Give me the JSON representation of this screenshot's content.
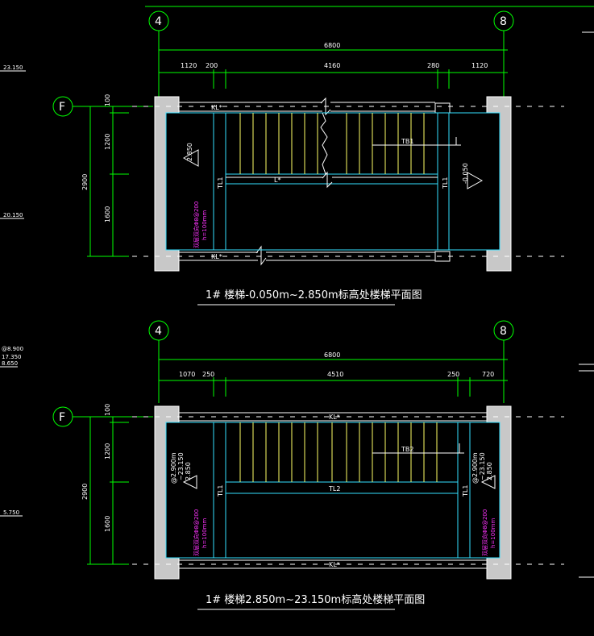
{
  "axes": {
    "left": "4",
    "right": "8",
    "row": "F"
  },
  "plan1": {
    "title": "1# 楼梯-0.050m~2.850m标高处楼梯平面图",
    "overall": "6800",
    "segments": [
      "1120",
      "200",
      "4160",
      "280",
      "1120"
    ],
    "vertical": {
      "total": "2900",
      "segments": [
        "100",
        "1200",
        "1600"
      ]
    },
    "beam_top": "KL*",
    "beam_bottom": "KL*",
    "beam_mid": "L*",
    "tb": "TB1",
    "tz_left": "TL1",
    "tz_right": "TL1",
    "level_left": "2.850",
    "level_right": "-0.050",
    "note_lines": [
      "双层双向Φ8@200",
      "h=100mm"
    ]
  },
  "plan2": {
    "title": "1# 楼梯2.850m~23.150m标高处楼梯平面图",
    "overall": "6800",
    "segments": [
      "1070",
      "250",
      "4510",
      "250",
      "720"
    ],
    "vertical": {
      "total": "2900",
      "segments": [
        "100",
        "1200",
        "1600"
      ]
    },
    "beam_top": "KL*",
    "beam_bottom": "KL*",
    "beam_mid": "TL2",
    "tb": "TB2",
    "tz_left": "TL1",
    "tz_right": "TL1",
    "level_left": [
      "@2.900m",
      "~23.150",
      "2.850"
    ],
    "level_right": [
      "@2.900m",
      "~23.150",
      "2.850"
    ],
    "note_lines": [
      "双层双向Φ8@200",
      "h=100mm"
    ]
  },
  "left_edge_levels": [
    "23.150",
    "20.150",
    "@8.900",
    "17.350",
    "8.650",
    "5.750"
  ]
}
